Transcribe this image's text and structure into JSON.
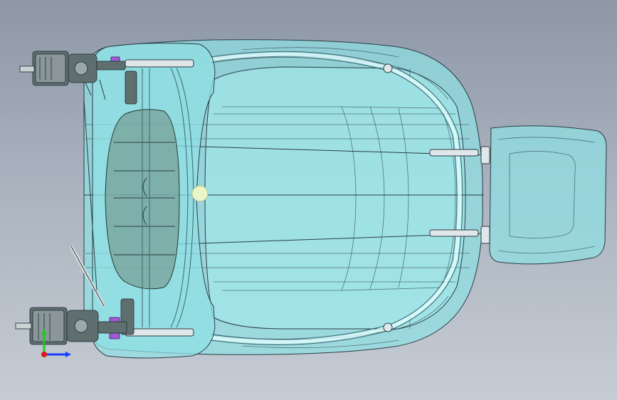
{
  "viewport": {
    "background_top": "#8d97a6",
    "background_bottom": "#c6ccd4"
  },
  "model": {
    "parts": [
      "seat-cushion",
      "seat-back",
      "headrest",
      "seat-frame",
      "seat-rails",
      "recliner-mechanism",
      "center-sphere"
    ],
    "colors": {
      "glass": "#8fe0e4",
      "frame": "#2a3d44",
      "accent": "#a05ad6"
    }
  },
  "triad": {
    "axes": [
      "x-axis",
      "y-axis",
      "z-axis"
    ],
    "colors": {
      "x": "#1a3cff",
      "y": "#22c722",
      "z": "#e01818"
    }
  }
}
